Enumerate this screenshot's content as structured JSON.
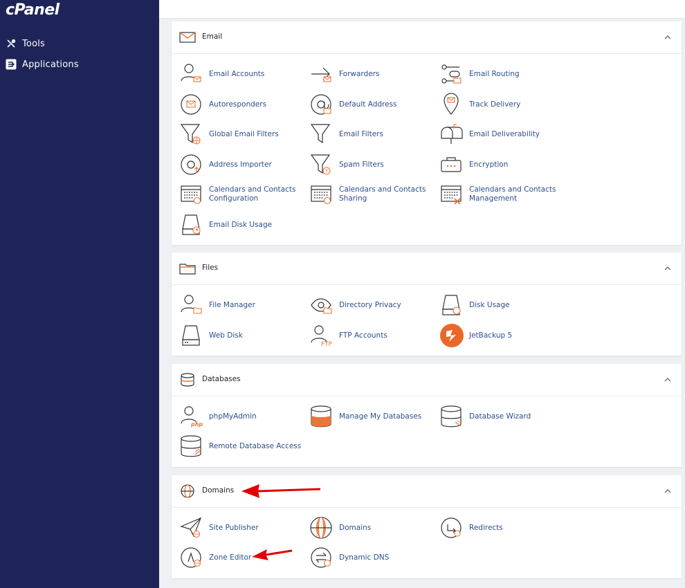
{
  "sidebar": {
    "logo": "cPanel",
    "items": [
      {
        "label": "Tools"
      },
      {
        "label": "Applications"
      }
    ]
  },
  "sections": {
    "email": {
      "title": "Email",
      "items": [
        {
          "label": "Email Accounts"
        },
        {
          "label": "Forwarders"
        },
        {
          "label": "Email Routing"
        },
        {
          "label": "Autoresponders"
        },
        {
          "label": "Default Address"
        },
        {
          "label": "Track Delivery"
        },
        {
          "label": "Global Email Filters"
        },
        {
          "label": "Email Filters"
        },
        {
          "label": "Email Deliverability"
        },
        {
          "label": "Address Importer"
        },
        {
          "label": "Spam Filters"
        },
        {
          "label": "Encryption"
        },
        {
          "label": "Calendars and Contacts Configuration"
        },
        {
          "label": "Calendars and Contacts Sharing"
        },
        {
          "label": "Calendars and Contacts Management"
        },
        {
          "label": "Email Disk Usage"
        }
      ]
    },
    "files": {
      "title": "Files",
      "items": [
        {
          "label": "File Manager"
        },
        {
          "label": "Directory Privacy"
        },
        {
          "label": "Disk Usage"
        },
        {
          "label": "Web Disk"
        },
        {
          "label": "FTP Accounts"
        },
        {
          "label": "JetBackup 5"
        }
      ]
    },
    "databases": {
      "title": "Databases",
      "items": [
        {
          "label": "phpMyAdmin"
        },
        {
          "label": "Manage My Databases"
        },
        {
          "label": "Database Wizard"
        },
        {
          "label": "Remote Database Access"
        }
      ]
    },
    "domains": {
      "title": "Domains",
      "items": [
        {
          "label": "Site Publisher"
        },
        {
          "label": "Domains"
        },
        {
          "label": "Redirects"
        },
        {
          "label": "Zone Editor"
        },
        {
          "label": "Dynamic DNS"
        }
      ]
    }
  },
  "colors": {
    "sidebar_bg": "#1f2458",
    "link": "#2c4f8c",
    "accent_orange": "#e8773a",
    "annotation_red": "#e00000"
  },
  "icons": {
    "phpmyadmin_badge": "php",
    "ftp_badge": "FTP"
  }
}
